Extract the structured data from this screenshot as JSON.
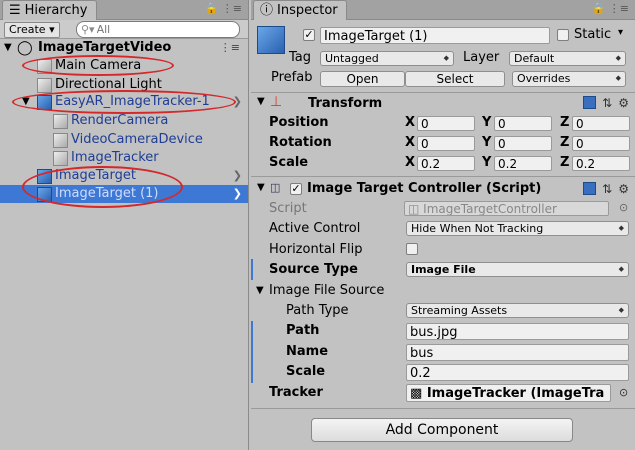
{
  "hierarchy": {
    "tab_label": "Hierarchy",
    "create_label": "Create",
    "search_placeholder": "All",
    "scene_name": "ImageTargetVideo",
    "items": [
      {
        "label": "Main Camera"
      },
      {
        "label": "Directional Light"
      },
      {
        "label": "EasyAR_ImageTracker-1"
      },
      {
        "label": "RenderCamera"
      },
      {
        "label": "VideoCameraDevice"
      },
      {
        "label": "ImageTracker"
      },
      {
        "label": "ImageTarget"
      },
      {
        "label": "ImageTarget (1)"
      }
    ]
  },
  "inspector": {
    "tab_label": "Inspector",
    "object_name": "ImageTarget (1)",
    "static_label": "Static",
    "tag_label": "Tag",
    "tag_value": "Untagged",
    "layer_label": "Layer",
    "layer_value": "Default",
    "prefab_label": "Prefab",
    "prefab_open": "Open",
    "prefab_select": "Select",
    "prefab_overrides": "Overrides",
    "transform": {
      "title": "Transform",
      "axis_labels": [
        "X",
        "Y",
        "Z"
      ],
      "position_label": "Position",
      "position": [
        "0",
        "0",
        "0"
      ],
      "rotation_label": "Rotation",
      "rotation": [
        "0",
        "0",
        "0"
      ],
      "scale_label": "Scale",
      "scale": [
        "0.2",
        "0.2",
        "0.2"
      ]
    },
    "controller": {
      "title": "Image Target Controller (Script)",
      "script_label": "Script",
      "script_value": "ImageTargetController",
      "active_control_label": "Active Control",
      "active_control_value": "Hide When Not Tracking",
      "horizontal_flip_label": "Horizontal Flip",
      "source_type_label": "Source Type",
      "source_type_value": "Image File",
      "image_file_source_label": "Image File Source",
      "path_type_label": "Path Type",
      "path_type_value": "Streaming Assets",
      "path_label": "Path",
      "path_value": "bus.jpg",
      "name_label": "Name",
      "name_value": "bus",
      "scale_label": "Scale",
      "scale_value": "0.2",
      "tracker_label": "Tracker",
      "tracker_value": "ImageTracker (ImageTra"
    },
    "add_component_label": "Add Component"
  },
  "colors": {
    "selection": "#3d79d4",
    "annotation": "#d5282a",
    "prefab_text": "#1f3d94"
  }
}
